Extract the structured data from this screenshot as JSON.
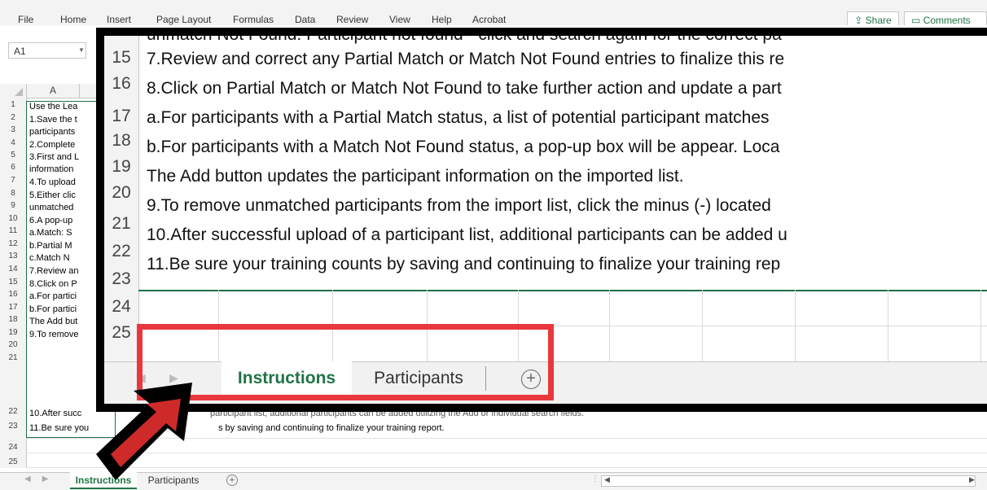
{
  "menu": {
    "items": [
      "File",
      "Home",
      "Insert",
      "Page Layout",
      "Formulas",
      "Data",
      "Review",
      "View",
      "Help",
      "Acrobat"
    ],
    "share_label": "Share",
    "comments_label": "Comments"
  },
  "formula_bar": {
    "name_box": "A1"
  },
  "background_sheet": {
    "column_header": "A",
    "row_numbers": [
      "1",
      "2",
      "3",
      "4",
      "5",
      "6",
      "7",
      "8",
      "9",
      "10",
      "11",
      "12",
      "13",
      "14",
      "15",
      "16",
      "17",
      "18",
      "19",
      "20",
      "21",
      "22",
      "23",
      "24",
      "25"
    ],
    "lines": [
      "Use the  Lea",
      "1.Save the t",
      "participants",
      "2.Complete",
      "3.First and L",
      "information",
      "4.To upload",
      "5.Either clic",
      "unmatched",
      "6.A pop-up",
      "  a.Match: S",
      "  b.Partial M",
      "  c.Match N",
      "7.Review an",
      "8.Click on P",
      "a.For partici",
      "b.For partici",
      "The Add but",
      "9.To remove",
      "10.After succ",
      "11.Be sure you"
    ],
    "line_22_tail": "participant list, additional participants can be added utilizing the Add or individual search fields.",
    "line_23_tail": "s by saving and continuing to finalize your training report.",
    "tabs": [
      "Instructions",
      "Participants"
    ]
  },
  "zoom_inset": {
    "top_partial": "unmatch Not Found: Participant not found - click and search again for the correct pa",
    "row_numbers": [
      "15",
      "16",
      "17",
      "18",
      "19",
      "20",
      "21",
      "22",
      "23",
      "24",
      "25"
    ],
    "lines": [
      "7.Review and correct any Partial Match or Match Not Found entries to finalize this re",
      "8.Click on Partial Match or Match Not Found to take further action and update a part",
      "a.For participants with a Partial Match status, a list of potential participant matches",
      "b.For participants with a Match Not Found status, a  pop-up box will be appear. Loca",
      "The Add button updates the participant information on the imported list.",
      "9.To remove unmatched participants from the import list, click the minus (-) located",
      "10.After successful upload of a participant list, additional participants can be added u",
      "11.Be sure your training counts by saving and continuing to finalize your training rep"
    ],
    "tabs": {
      "instructions": "Instructions",
      "participants": "Participants"
    }
  },
  "colors": {
    "excel_green": "#217346",
    "highlight_red": "#e8383d",
    "annotation_black": "#000000"
  }
}
